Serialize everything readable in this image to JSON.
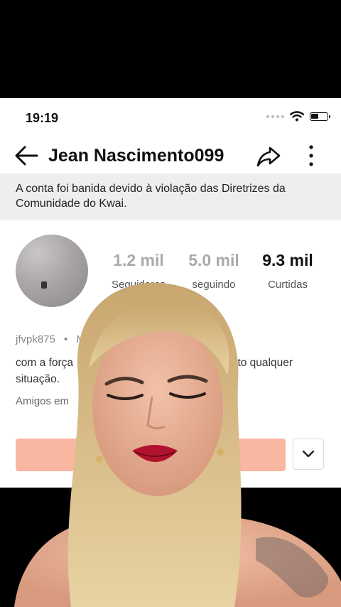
{
  "status_bar": {
    "time": "19:19"
  },
  "header": {
    "title": "Jean Nascimento099"
  },
  "ban_notice": {
    "text": "A conta foi banida devido à violação das Diretrizes da Comunidade do Kwai."
  },
  "stats": [
    {
      "value": "1.2 mil",
      "label": "Seguidores"
    },
    {
      "value": "5.0 mil",
      "label": "seguindo"
    },
    {
      "value": "9.3 mil",
      "label": "Curtidas"
    }
  ],
  "profile": {
    "username": "jfvpk875",
    "meta_separator": "•",
    "meta_partial": "M",
    "bio_left": "com a força",
    "bio_right": "to qualquer",
    "bio_line2": "situação.",
    "friends_partial": "Amigos em"
  },
  "colors": {
    "follow_button": "#f9b6a0",
    "ban_bg": "#eeeeee"
  }
}
